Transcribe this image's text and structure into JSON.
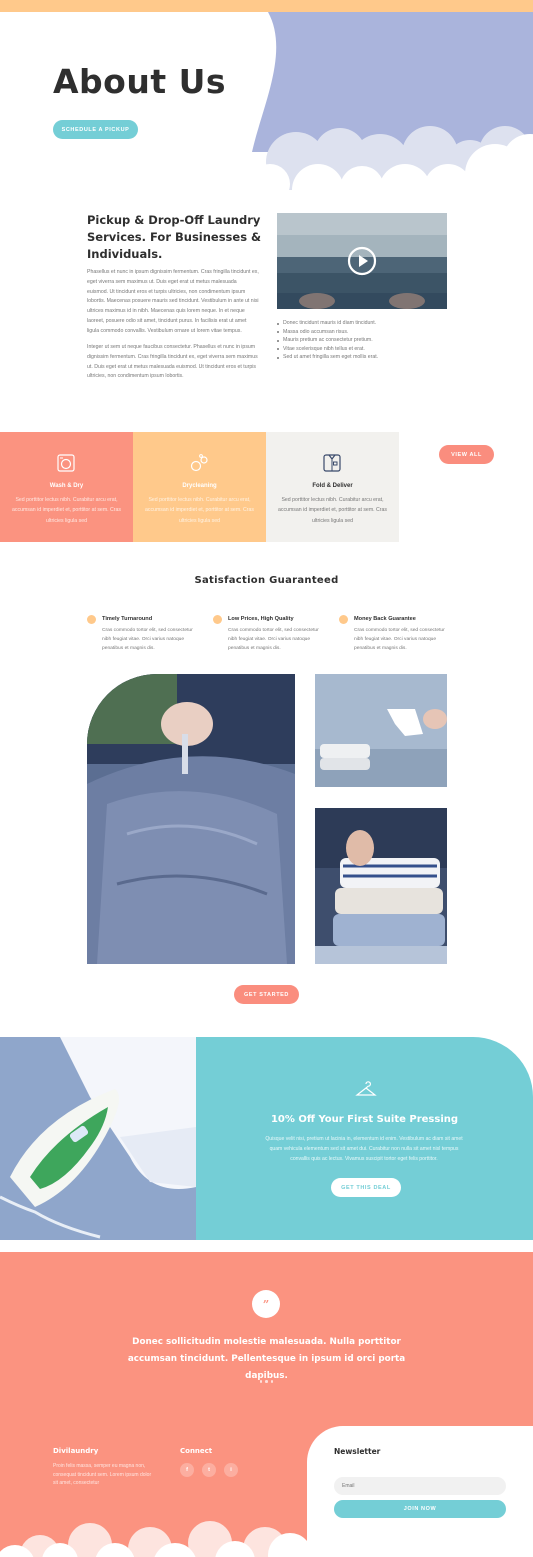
{
  "hero": {
    "title": "About Us",
    "button_label": "SCHEDULE A PICKUP"
  },
  "intro": {
    "title": "Pickup & Drop-Off Laundry Services. For Businesses & Individuals.",
    "paragraph1": "Phasellus et nunc in ipsum dignissim fermentum. Cras fringilla tincidunt ex, eget viverra sem maximus ut. Duis eget erat ut metus malesuada euismod. Ut tincidunt eros et turpis ultricies, non condimentum ipsum lobortis. Maecenas posuere mauris sed tincidunt. Vestibulum in ante ut nisi ultrices maximus id in nibh. Maecenas quis lorem neque. In et neque laoreet, posuere odio sit amet, tincidunt purus. In facilisis erat ut amet ligula commodo convallis. Vestibulum ornare ut lorem vitae tempus.",
    "paragraph2": "Integer ut sem ut neque faucibus consectetur. Phasellus et nunc in ipsum dignissim fermentum. Cras fringilla tincidunt ex, eget viverra sem maximus ut. Duis eget erat ut metus malesuada euismod. Ut tincidunt eros et turpis ultricies, non condimentum ipsum lobortis.",
    "bullets": [
      "Donec tincidunt mauris id diam tincidunt.",
      "Massa odio accumsan risus.",
      "Mauris pretium ac consectetur pretium.",
      "Vitae scelerisque nibh tellus et erat.",
      "Sed ut amet fringilla sem eget mollis erat."
    ]
  },
  "services": {
    "items": [
      {
        "title": "Wash & Dry",
        "desc": "Sed porttitor lectus nibh. Curabitur arcu erat, accumsan id imperdiet et, porttitor at sem. Cras ultricies ligula sed",
        "icon": "washing-machine-icon"
      },
      {
        "title": "Drycleaning",
        "desc": "Sed porttitor lectus nibh. Curabitur arcu erat, accumsan id imperdiet et, porttitor at sem. Cras ultricies ligula sed",
        "icon": "bubbles-icon"
      },
      {
        "title": "Fold & Deliver",
        "desc": "Sed porttitor lectus nibh. Curabitur arcu erat, accumsan id imperdiet et, porttitor at sem. Cras ultricies ligula sed",
        "icon": "folded-shirt-icon"
      }
    ],
    "view_all_label": "VIEW ALL"
  },
  "satisfaction": {
    "title": "Satisfaction Guaranteed",
    "features": [
      {
        "title": "Timely Turnaround",
        "desc": "Cras commodo tortor elit, sed consectetur nibh feugiat vitae. Orci varius natoque penatibus et magnis dis."
      },
      {
        "title": "Low Prices, High Quality",
        "desc": "Cras commodo tortor elit, sed consectetur nibh feugiat vitae. Orci varius natoque penatibus et magnis dis."
      },
      {
        "title": "Money Back Guarantee",
        "desc": "Cras commodo tortor elit, sed consectetur nibh feugiat vitae. Orci varius natoque penatibus et magnis dis."
      }
    ],
    "button_label": "GET STARTED"
  },
  "promo": {
    "title": "10% Off Your First Suite Pressing",
    "desc": "Quisque velit nisi, pretium ut lacinia in, elementum id enim. Vestibulum ac diam sit amet quam vehicula elementum sed sit amet dui. Curabitur non nulla sit amet nisl tempus convallis quis ac lectus. Vivamus suscipit tortor eget felis porttitor.",
    "button_label": "GET THIS DEAL"
  },
  "testimonial": {
    "quote_mark": "”",
    "text": "Donec sollicitudin molestie malesuada. Nulla porttitor accumsan tincidunt. Pellentesque in ipsum id orci porta dapibus."
  },
  "footer": {
    "brand": "Divilaundry",
    "brand_desc": "Proin felis massa, semper eu magna non, consequat tincidunt sem. Lorem ipsum dolor sit amet, consectetur",
    "connect_title": "Connect",
    "social": [
      "f",
      "t",
      "i"
    ],
    "newsletter_title": "Newsletter",
    "email_placeholder": "Email",
    "join_label": "JOIN NOW"
  },
  "colors": {
    "coral": "#fb9380",
    "peach": "#ffc98b",
    "teal": "#74ced6",
    "periwinkle": "#a9b3d9",
    "light_gray": "#f2f1ee"
  }
}
